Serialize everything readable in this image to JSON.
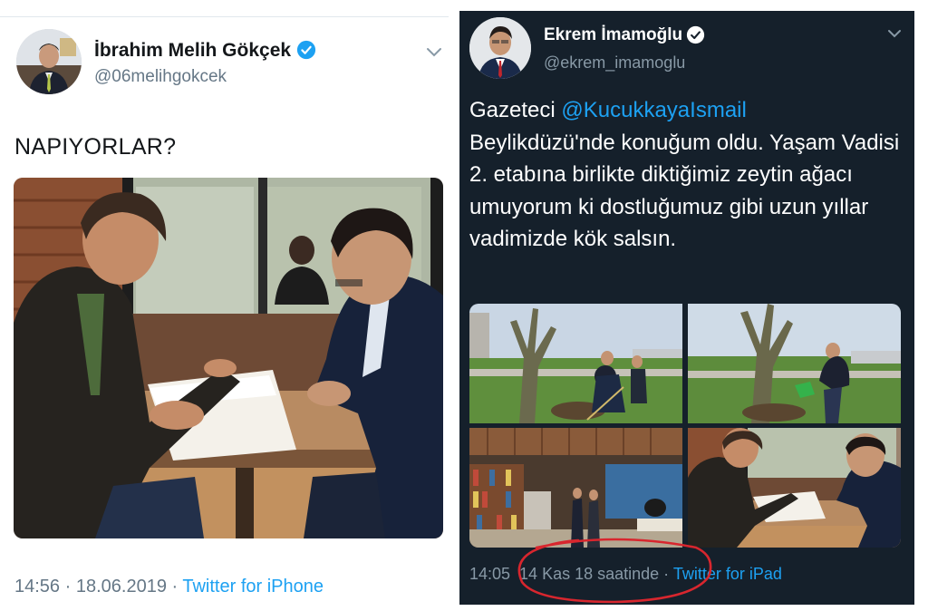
{
  "left_tweet": {
    "display_name": "İbrahim Melih Gökçek",
    "handle": "@06melihgokcek",
    "text": "NAPIYORLAR?",
    "time": "14:56",
    "separator": " · ",
    "date": "18.06.2019",
    "source": "Twitter for iPhone",
    "icons": {
      "verified": "verified-badge-icon",
      "menu": "chevron-down-icon"
    },
    "colors": {
      "background": "#ffffff",
      "text": "#14171a",
      "muted": "#657786",
      "accent": "#1da1f2"
    }
  },
  "right_tweet": {
    "display_name": "Ekrem İmamoğlu",
    "handle": "@ekrem_imamoglu",
    "text": {
      "prefix": "Gazeteci ",
      "mention": "@KucukkayaIsmail",
      "body": "Beylikdüzü'nde konuğum oldu. Yaşam Vadisi 2. etabına birlikte diktiğimiz zeytin ağacı umuyorum ki dostluğumuz gibi uzun yıllar vadimizde kök salsın."
    },
    "time": "14:05",
    "date": "14 Kas 18 saatinde",
    "separator": " · ",
    "source": "Twitter for iPad",
    "icons": {
      "verified": "verified-badge-icon",
      "menu": "chevron-down-icon"
    },
    "colors": {
      "background": "#15202b",
      "text": "#ffffff",
      "muted": "#8899a6",
      "accent": "#1da1f2",
      "annotation": "#d8262e"
    }
  }
}
